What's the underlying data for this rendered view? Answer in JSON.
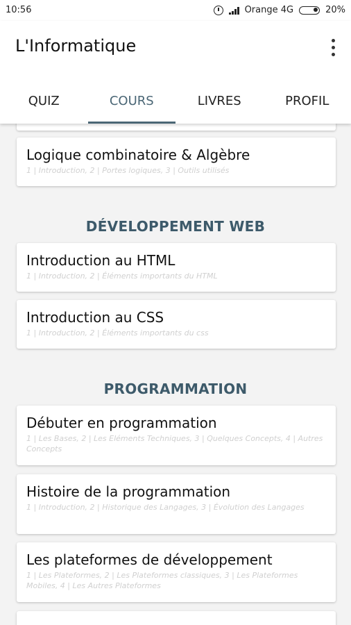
{
  "status_bar": {
    "time": "10:56",
    "carrier": "Orange 4G",
    "battery": "20%"
  },
  "app": {
    "title": "L'Informatique"
  },
  "tabs": [
    {
      "label": "QUIZ"
    },
    {
      "label": "COURS"
    },
    {
      "label": "LIVRES"
    },
    {
      "label": "PROFIL"
    }
  ],
  "courses": {
    "top_card": {
      "title": "Logique combinatoire & Algèbre",
      "subtitle": "1 | Introduction, 2 | Portes logiques, 3 | Outils utilisés"
    },
    "web": {
      "title": "DÉVELOPPEMENT WEB",
      "items": [
        {
          "title": "Introduction au HTML",
          "subtitle": "1 | Introduction, 2 | Éléments importants du HTML"
        },
        {
          "title": "Introduction au CSS",
          "subtitle": "1 | Introduction, 2 | Éléments importants du css"
        }
      ]
    },
    "programming": {
      "title": "PROGRAMMATION",
      "items": [
        {
          "title": "Débuter en programmation",
          "subtitle": "1 | Les Bases, 2 | Les Eléments Techniques, 3 | Quelques Concepts, 4 | Autres Concepts"
        },
        {
          "title": "Histoire de la programmation",
          "subtitle": "1 | Introduction, 2 | Historique des Langages, 3 | Évolution des Langages"
        },
        {
          "title": "Les plateformes de développement",
          "subtitle": "1 | Les Plateformes, 2 | Les Plateformes classiques, 3 | Les Plateformes Mobiles, 4 | Les Autres Plateformes"
        }
      ]
    }
  }
}
